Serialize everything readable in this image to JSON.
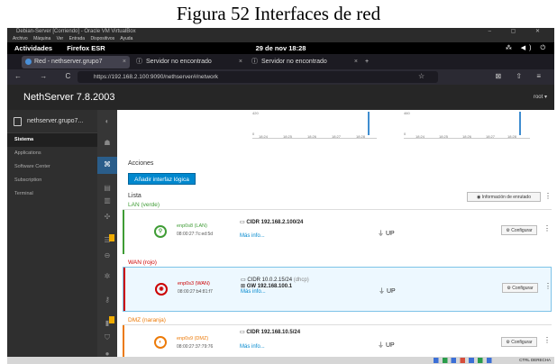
{
  "caption": "Figura 52 Interfaces de red",
  "vbox": {
    "title": "Debian-Server [Corriendo] - Oracle VM VirtualBox",
    "window_controls": "– ▢ ✕",
    "menu": [
      "Archivo",
      "Máquina",
      "Ver",
      "Entrada",
      "Dispositivos",
      "Ayuda"
    ]
  },
  "gnome": {
    "activities": "Actividades",
    "app": "Firefox ESR",
    "clock": "29 de nov 18:28",
    "tray": "⁂ ◀) ⏻"
  },
  "tabs": [
    {
      "label": "Red - nethserver.grupo7",
      "active": true
    },
    {
      "label": "Servidor no encontrado"
    },
    {
      "label": "Servidor no encontrado"
    }
  ],
  "tab_new": "+",
  "urlbar": {
    "nav": "← → C",
    "url_host": "https://192.168.2.100",
    "url_path": ":9090/nethserver#/network",
    "star": "☆",
    "right_icons": "⊠ ⇧ ≡"
  },
  "nethserver": {
    "brand": "NethServer 7.8.2003",
    "user": "root ▾",
    "host": "nethserver.grupo7..."
  },
  "sidebar": [
    "Sistema",
    "Applications",
    "Software Center",
    "Subscription",
    "Terminal"
  ],
  "content": {
    "actions_title": "Acciones",
    "add_button": "Añadir interfaz lógica",
    "list_title": "Lista",
    "info_button": "Información de enrutado",
    "chart_ticks_left": [
      "18:24",
      "18:25",
      "18:26",
      "18:27",
      "18:28"
    ],
    "chart_ticks_right": [
      "18:24",
      "18:25",
      "18:26",
      "18:27",
      "18:28"
    ],
    "chart_max_left": "420",
    "chart_max_right": "460",
    "chart_zero": "0"
  },
  "zones": [
    {
      "label": "LAN (verde)",
      "color": "#3f9c35",
      "iface": "enp0s8 (LAN)",
      "mac": "08:00:27:7c:ed:5d",
      "cidr": "CIDR 192.168.2.100/24",
      "cidr_extra": "",
      "gw": "",
      "more": "Más info...",
      "status": "UP",
      "configure": "Configurar"
    },
    {
      "label": "WAN (rojo)",
      "color": "#cc0000",
      "iface": "enp0s3 (WAN)",
      "mac": "08:00:27:b4:81:f7",
      "cidr": "CIDR 10.0.2.15/24",
      "cidr_extra": "(dhcp)",
      "gw": "GW 192.168.100.1",
      "more": "Más info...",
      "status": "UP",
      "configure": "Configurar"
    },
    {
      "label": "DMZ (naranja)",
      "color": "#ec7a08",
      "iface": "enp0s9 (DMZ)",
      "mac": "08:00:27:37:79:76",
      "cidr": "CIDR 192.168.10.5/24",
      "cidr_extra": "",
      "gw": "",
      "more": "Más info...",
      "status": "UP",
      "configure": "Configurar"
    }
  ],
  "taskbar": {
    "right": "CTRL DERECHA"
  }
}
